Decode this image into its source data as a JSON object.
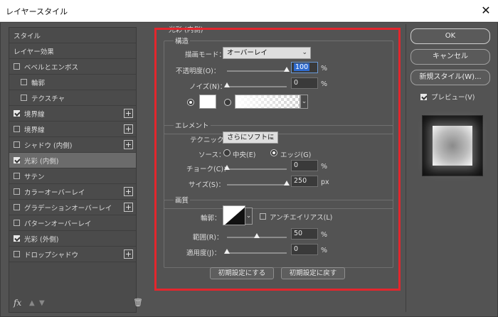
{
  "window": {
    "title": "レイヤースタイル",
    "close_glyph": "✕"
  },
  "left_panel": {
    "items": [
      {
        "label": "スタイル",
        "checkbox": false,
        "checked": false,
        "plus": false,
        "selected": false,
        "indent": 0
      },
      {
        "label": "レイヤー効果",
        "checkbox": false,
        "checked": false,
        "plus": false,
        "selected": false,
        "indent": 0
      },
      {
        "label": "ベベルとエンボス",
        "checkbox": true,
        "checked": false,
        "plus": false,
        "selected": false,
        "indent": 0
      },
      {
        "label": "輪郭",
        "checkbox": true,
        "checked": false,
        "plus": false,
        "selected": false,
        "indent": 1
      },
      {
        "label": "テクスチャ",
        "checkbox": true,
        "checked": false,
        "plus": false,
        "selected": false,
        "indent": 1
      },
      {
        "label": "境界線",
        "checkbox": true,
        "checked": true,
        "plus": true,
        "selected": false,
        "indent": 0
      },
      {
        "label": "境界線",
        "checkbox": true,
        "checked": false,
        "plus": true,
        "selected": false,
        "indent": 0
      },
      {
        "label": "シャドウ (内側)",
        "checkbox": true,
        "checked": false,
        "plus": true,
        "selected": false,
        "indent": 0
      },
      {
        "label": "光彩 (内側)",
        "checkbox": true,
        "checked": true,
        "plus": false,
        "selected": true,
        "indent": 0
      },
      {
        "label": "サテン",
        "checkbox": true,
        "checked": false,
        "plus": false,
        "selected": false,
        "indent": 0
      },
      {
        "label": "カラーオーバーレイ",
        "checkbox": true,
        "checked": false,
        "plus": true,
        "selected": false,
        "indent": 0
      },
      {
        "label": "グラデーションオーバーレイ",
        "checkbox": true,
        "checked": false,
        "plus": true,
        "selected": false,
        "indent": 0
      },
      {
        "label": "パターンオーバーレイ",
        "checkbox": true,
        "checked": false,
        "plus": false,
        "selected": false,
        "indent": 0
      },
      {
        "label": "光彩 (外側)",
        "checkbox": true,
        "checked": true,
        "plus": false,
        "selected": false,
        "indent": 0
      },
      {
        "label": "ドロップシャドウ",
        "checkbox": true,
        "checked": false,
        "plus": true,
        "selected": false,
        "indent": 0
      }
    ],
    "plus_glyph": "+",
    "footer": {
      "fx": "fx",
      "up_glyph": "▲",
      "down_glyph": "▼",
      "trash_glyph": "🗑"
    }
  },
  "middle_panel": {
    "title": "光彩 (内側)",
    "structure": {
      "label": "構造",
      "blend_mode_label": "描画モード：",
      "blend_mode_value": "オーバーレイ",
      "opacity_label": "不透明度(O)：",
      "opacity_value": "100",
      "opacity_fraction": 1.0,
      "noise_label": "ノイズ(N)：",
      "noise_value": "0",
      "noise_fraction": 0.0,
      "percent": "%"
    },
    "elements": {
      "label": "エレメント",
      "technique_label": "テクニック：",
      "technique_value": "さらにソフトに",
      "source_label": "ソース：",
      "source_center": "中央(E)",
      "source_edge": "エッジ(G)",
      "choke_label": "チョーク(C)：",
      "choke_value": "0",
      "choke_fraction": 0.0,
      "size_label": "サイズ(S)：",
      "size_value": "250",
      "size_fraction": 1.0,
      "percent": "%",
      "px": "px"
    },
    "quality": {
      "label": "画質",
      "contour_label": "輪郭：",
      "antialias_label": "アンチエイリアス(L)",
      "range_label": "範囲(R)：",
      "range_value": "50",
      "range_fraction": 0.5,
      "jitter_label": "適用度(J)：",
      "jitter_value": "0",
      "jitter_fraction": 0.0,
      "percent": "%"
    },
    "buttons": {
      "make_default": "初期設定にする",
      "reset_default": "初期設定に戻す"
    },
    "chevron_glyph": "⌄"
  },
  "right_panel": {
    "ok": "OK",
    "cancel": "キャンセル",
    "new_style": "新規スタイル(W)...",
    "preview_label": "プレビュー(V)",
    "preview_checked": true
  }
}
